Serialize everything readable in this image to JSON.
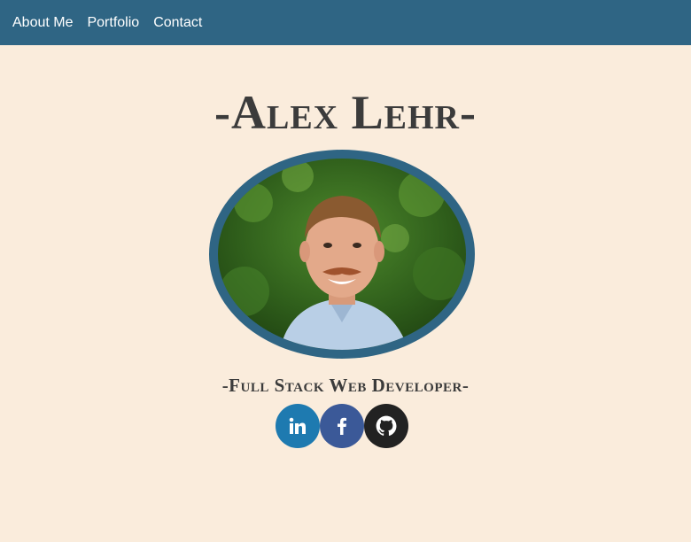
{
  "nav": {
    "items": [
      {
        "label": "About Me"
      },
      {
        "label": "Portfolio"
      },
      {
        "label": "Contact"
      }
    ]
  },
  "hero": {
    "name": "-Alex Lehr-",
    "subtitle": "-Full Stack Web Developer-",
    "portrait": "profile-photo"
  },
  "socials": [
    {
      "icon": "linkedin-icon",
      "color": "#1e7ab0"
    },
    {
      "icon": "facebook-icon",
      "color": "#3b5998"
    },
    {
      "icon": "github-icon",
      "color": "#222222"
    }
  ],
  "colors": {
    "navbar": "#2f6584",
    "background": "#faecdc",
    "text": "#3b3b3b",
    "frame": "#2f6584"
  }
}
